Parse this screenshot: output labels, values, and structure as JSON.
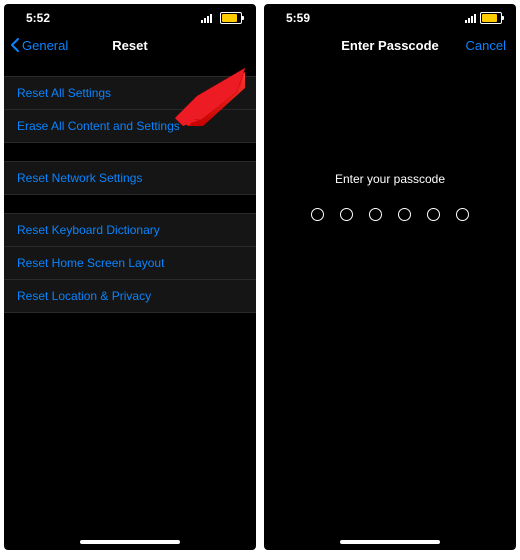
{
  "left": {
    "status": {
      "time": "5:52"
    },
    "nav": {
      "back": "General",
      "title": "Reset"
    },
    "groups": [
      {
        "items": [
          "Reset All Settings",
          "Erase All Content and Settings"
        ]
      },
      {
        "items": [
          "Reset Network Settings"
        ]
      },
      {
        "items": [
          "Reset Keyboard Dictionary",
          "Reset Home Screen Layout",
          "Reset Location & Privacy"
        ]
      }
    ],
    "highlight_target": "Erase All Content and Settings"
  },
  "right": {
    "status": {
      "time": "5:59"
    },
    "nav": {
      "title": "Enter Passcode",
      "cancel": "Cancel"
    },
    "prompt": "Enter your passcode",
    "digits": 6
  },
  "colors": {
    "link": "#0a84ff",
    "battery": "#ffcc00",
    "arrow": "#f01d1d"
  }
}
